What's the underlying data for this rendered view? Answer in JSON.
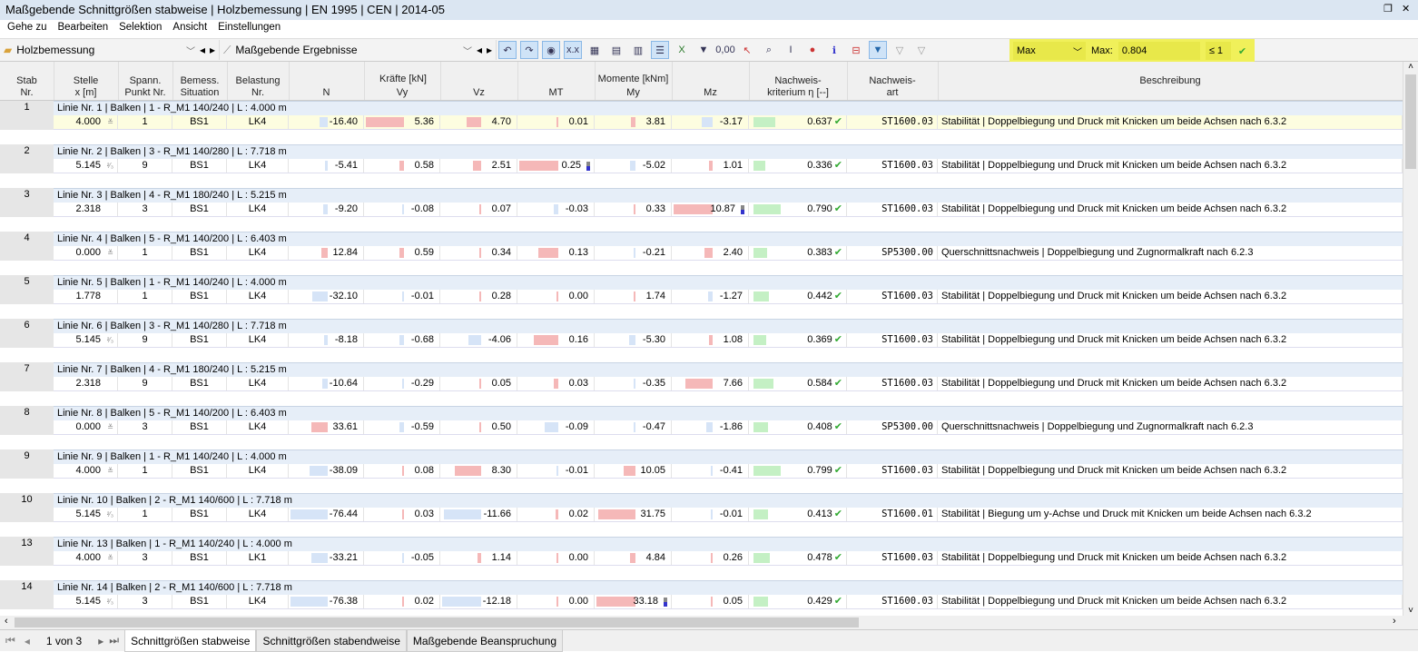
{
  "window": {
    "title": "Maßgebende Schnittgrößen stabweise | Holzbemessung | EN 1995 | CEN | 2014-05"
  },
  "menu": [
    "Gehe zu",
    "Bearbeiten",
    "Selektion",
    "Ansicht",
    "Einstellungen"
  ],
  "toolbar": {
    "module": "Holzbemessung",
    "result": "Maßgebende Ergebnisse",
    "filter_mode": "Max",
    "max_label": "Max:",
    "max_value": "0.804",
    "limit": "≤ 1"
  },
  "colors": {
    "negative_bar": "#d6e4f7",
    "positive_bar": "#f5b8b8",
    "eta_bar": "#c4f0c4",
    "highlight": "#f0f05a",
    "selected_row": "#fdfde0"
  },
  "headers": {
    "stab": "Stab\nNr.",
    "stelle": "Stelle\nx [m]",
    "spann": "Spann.\nPunkt Nr.",
    "bemess": "Bemess.\nSituation",
    "belastung": "Belastung\nNr.",
    "kraefte": "Kräfte [kN]",
    "momente": "Momente [kNm]",
    "n": "N",
    "vy": "Vy",
    "vz": "Vz",
    "mt": "MT",
    "my": "My",
    "mz": "Mz",
    "krit": "Nachweis-\nkriterium η [--]",
    "art": "Nachweis-\nart",
    "beschreibung": "Beschreibung"
  },
  "rows": [
    {
      "stab": "1",
      "line": "Linie Nr. 1 | Balken | 1 - R_M1 140/240 | L : 4.000 m",
      "x": "4.000",
      "mark": "≚",
      "p": "1",
      "bs": "BS1",
      "lk": "LK4",
      "vals": [
        "-16.40",
        "5.36",
        "4.70",
        "0.01",
        "3.81",
        "-3.17"
      ],
      "max": -1,
      "eta": "0.637",
      "art": "ST1600.03",
      "desc": "Stabilität | Doppelbiegung und Druck mit Knicken um beide Achsen nach 6.3.2",
      "selected": true
    },
    {
      "stab": "2",
      "line": "Linie Nr. 2 | Balken | 3 - R_M1 140/280 | L : 7.718 m",
      "x": "5.145",
      "mark": "²⁄₃",
      "p": "9",
      "bs": "BS1",
      "lk": "LK4",
      "vals": [
        "-5.41",
        "0.58",
        "2.51",
        "0.25",
        "-5.02",
        "1.01"
      ],
      "max": 3,
      "eta": "0.336",
      "art": "ST1600.03",
      "desc": "Stabilität | Doppelbiegung und Druck mit Knicken um beide Achsen nach 6.3.2"
    },
    {
      "stab": "3",
      "line": "Linie Nr. 3 | Balken | 4 - R_M1 180/240 | L : 5.215 m",
      "x": "2.318",
      "mark": "",
      "p": "3",
      "bs": "BS1",
      "lk": "LK4",
      "vals": [
        "-9.20",
        "-0.08",
        "0.07",
        "-0.03",
        "0.33",
        "10.87"
      ],
      "max": 5,
      "eta": "0.790",
      "art": "ST1600.03",
      "desc": "Stabilität | Doppelbiegung und Druck mit Knicken um beide Achsen nach 6.3.2"
    },
    {
      "stab": "4",
      "line": "Linie Nr. 4 | Balken | 5 - R_M1 140/200 | L : 6.403 m",
      "x": "0.000",
      "mark": "≚",
      "p": "1",
      "bs": "BS1",
      "lk": "LK4",
      "vals": [
        "12.84",
        "0.59",
        "0.34",
        "0.13",
        "-0.21",
        "2.40"
      ],
      "max": -1,
      "eta": "0.383",
      "art": "SP5300.00",
      "desc": "Querschnittsnachweis | Doppelbiegung und Zugnormalkraft nach 6.2.3"
    },
    {
      "stab": "5",
      "line": "Linie Nr. 5 | Balken | 1 - R_M1 140/240 | L : 4.000 m",
      "x": "1.778",
      "mark": "",
      "p": "1",
      "bs": "BS1",
      "lk": "LK4",
      "vals": [
        "-32.10",
        "-0.01",
        "0.28",
        "0.00",
        "1.74",
        "-1.27"
      ],
      "max": -1,
      "eta": "0.442",
      "art": "ST1600.03",
      "desc": "Stabilität | Doppelbiegung und Druck mit Knicken um beide Achsen nach 6.3.2"
    },
    {
      "stab": "6",
      "line": "Linie Nr. 6 | Balken | 3 - R_M1 140/280 | L : 7.718 m",
      "x": "5.145",
      "mark": "²⁄₃",
      "p": "9",
      "bs": "BS1",
      "lk": "LK4",
      "vals": [
        "-8.18",
        "-0.68",
        "-4.06",
        "0.16",
        "-5.30",
        "1.08"
      ],
      "max": -1,
      "eta": "0.369",
      "art": "ST1600.03",
      "desc": "Stabilität | Doppelbiegung und Druck mit Knicken um beide Achsen nach 6.3.2"
    },
    {
      "stab": "7",
      "line": "Linie Nr. 7 | Balken | 4 - R_M1 180/240 | L : 5.215 m",
      "x": "2.318",
      "mark": "",
      "p": "9",
      "bs": "BS1",
      "lk": "LK4",
      "vals": [
        "-10.64",
        "-0.29",
        "0.05",
        "0.03",
        "-0.35",
        "7.66"
      ],
      "max": -1,
      "eta": "0.584",
      "art": "ST1600.03",
      "desc": "Stabilität | Doppelbiegung und Druck mit Knicken um beide Achsen nach 6.3.2"
    },
    {
      "stab": "8",
      "line": "Linie Nr. 8 | Balken | 5 - R_M1 140/200 | L : 6.403 m",
      "x": "0.000",
      "mark": "≚",
      "p": "3",
      "bs": "BS1",
      "lk": "LK4",
      "vals": [
        "33.61",
        "-0.59",
        "0.50",
        "-0.09",
        "-0.47",
        "-1.86"
      ],
      "max": -1,
      "eta": "0.408",
      "art": "SP5300.00",
      "desc": "Querschnittsnachweis | Doppelbiegung und Zugnormalkraft nach 6.2.3"
    },
    {
      "stab": "9",
      "line": "Linie Nr. 9 | Balken | 1 - R_M1 140/240 | L : 4.000 m",
      "x": "4.000",
      "mark": "≚",
      "p": "1",
      "bs": "BS1",
      "lk": "LK4",
      "vals": [
        "-38.09",
        "0.08",
        "8.30",
        "-0.01",
        "10.05",
        "-0.41"
      ],
      "max": -1,
      "eta": "0.799",
      "art": "ST1600.03",
      "desc": "Stabilität | Doppelbiegung und Druck mit Knicken um beide Achsen nach 6.3.2"
    },
    {
      "stab": "10",
      "line": "Linie Nr. 10 | Balken | 2 - R_M1 140/600 | L : 7.718 m",
      "x": "5.145",
      "mark": "²⁄₃",
      "p": "1",
      "bs": "BS1",
      "lk": "LK4",
      "vals": [
        "-76.44",
        "0.03",
        "-11.66",
        "0.02",
        "31.75",
        "-0.01"
      ],
      "max": -1,
      "eta": "0.413",
      "art": "ST1600.01",
      "desc": "Stabilität | Biegung um y-Achse und Druck mit Knicken um beide Achsen nach 6.3.2"
    },
    {
      "stab": "13",
      "line": "Linie Nr. 13 | Balken | 1 - R_M1 140/240 | L : 4.000 m",
      "x": "4.000",
      "mark": "≚",
      "p": "3",
      "bs": "BS1",
      "lk": "LK1",
      "vals": [
        "-33.21",
        "-0.05",
        "1.14",
        "0.00",
        "4.84",
        "0.26"
      ],
      "max": -1,
      "eta": "0.478",
      "art": "ST1600.03",
      "desc": "Stabilität | Doppelbiegung und Druck mit Knicken um beide Achsen nach 6.3.2"
    },
    {
      "stab": "14",
      "line": "Linie Nr. 14 | Balken | 2 - R_M1 140/600 | L : 7.718 m",
      "x": "5.145",
      "mark": "²⁄₃",
      "p": "3",
      "bs": "BS1",
      "lk": "LK4",
      "vals": [
        "-76.38",
        "0.02",
        "-12.18",
        "0.00",
        "33.18",
        "0.05"
      ],
      "max": 4,
      "eta": "0.429",
      "art": "ST1600.03",
      "desc": "Stabilität | Doppelbiegung und Druck mit Knicken um beide Achsen nach 6.3.2"
    }
  ],
  "footer": {
    "page": "1 von 3",
    "tabs": [
      "Schnittgrößen stabweise",
      "Schnittgrößen stabendweise",
      "Maßgebende Beanspruchung"
    ]
  }
}
